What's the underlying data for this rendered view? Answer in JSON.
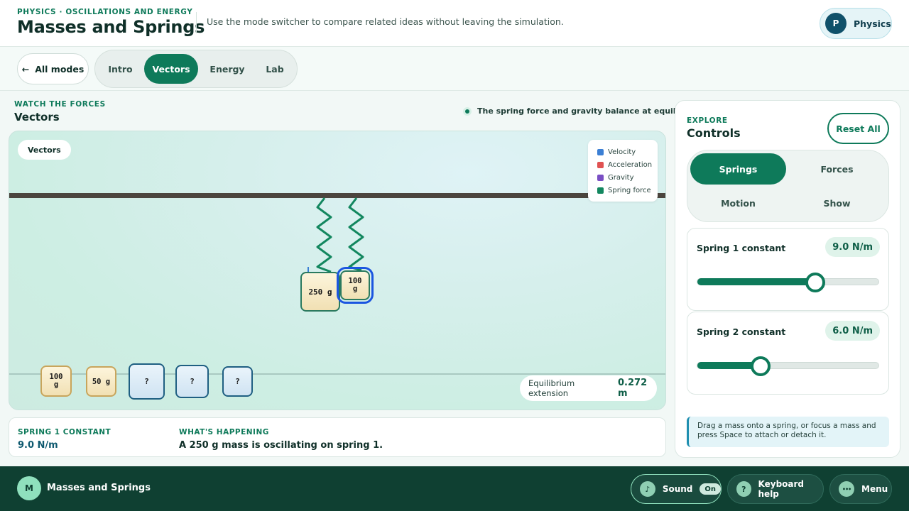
{
  "header": {
    "eyebrow": "PHYSICS · OSCILLATIONS AND ENERGY",
    "title": "Masses and Springs",
    "description": "Use the mode switcher to compare related ideas without leaving the simulation.",
    "profile_initial": "P",
    "profile_label": "Physics"
  },
  "modebar": {
    "back_arrow": "←",
    "back_label": "All modes",
    "tabs": [
      {
        "label": "Intro",
        "active": false
      },
      {
        "label": "Vectors",
        "active": true
      },
      {
        "label": "Energy",
        "active": false
      },
      {
        "label": "Lab",
        "active": false
      }
    ]
  },
  "sim": {
    "eyebrow": "WATCH THE FORCES",
    "title": "Vectors",
    "status": "The spring force and gravity balance at equilibrium.",
    "chip": "Vectors",
    "legend": [
      {
        "label": "Velocity",
        "color": "#3b7fd4"
      },
      {
        "label": "Acceleration",
        "color": "#e05252"
      },
      {
        "label": "Gravity",
        "color": "#7a4fc4"
      },
      {
        "label": "Spring force",
        "color": "#13875f"
      }
    ],
    "masses": {
      "hanging_1": "250 g",
      "hanging_2": "100 g",
      "shelf_1": "100 g",
      "shelf_2": "50 g",
      "shelf_3": "?",
      "shelf_4": "?",
      "shelf_5": "?"
    },
    "equilibrium_label": "Equilibrium extension",
    "equilibrium_value": "0.272 m"
  },
  "info": {
    "constant_label": "SPRING 1 CONSTANT",
    "constant_value": "9.0 N/m",
    "happening_label": "WHAT'S HAPPENING",
    "happening_text": "A 250 g mass is oscillating on spring 1."
  },
  "controls": {
    "eyebrow": "EXPLORE",
    "title": "Controls",
    "reset_label": "Reset All",
    "tabs": [
      {
        "label": "Springs",
        "active": true
      },
      {
        "label": "Forces",
        "active": false
      },
      {
        "label": "Motion",
        "active": false
      },
      {
        "label": "Show",
        "active": false
      }
    ],
    "spring1": {
      "label": "Spring 1 constant",
      "value_text": "9.0 N/m",
      "fraction": 0.65
    },
    "spring2": {
      "label": "Spring 2 constant",
      "value_text": "6.0 N/m",
      "fraction": 0.35
    },
    "hint": "Drag a mass onto a spring, or focus a mass and press Space to attach or detach it."
  },
  "footer": {
    "logo_initial": "M",
    "title": "Masses and Springs",
    "sound_icon": "♪",
    "sound_label": "Sound",
    "sound_state": "On",
    "help_icon": "?",
    "help_label": "Keyboard help",
    "menu_icon": "•••",
    "menu_label": "Menu"
  }
}
